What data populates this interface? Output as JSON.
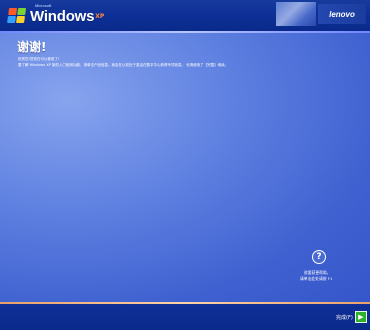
{
  "header": {
    "brand": "Windows",
    "brand_superscript": "Microsoft",
    "brand_edition": "XP",
    "oem_logo": "lenovo"
  },
  "main": {
    "title": "谢谢!",
    "line1": "祝贺您!您现在可以使用了!",
    "line2": "要了解 Windows XP 新的入门使用功能，请单击产品信息。我会在以前处于激活在数字中心获得专项信息。 也请使用了【完整】继续。"
  },
  "help": {
    "icon": "help-icon",
    "line1": "欲要获更帮助，",
    "line2": "请单击此处请按 F1"
  },
  "footer": {
    "finish_label": "完成(F)",
    "finish_icon": "arrow-right-icon"
  },
  "colors": {
    "topbar": "#0d2f96",
    "content": "#5d7fe0",
    "bottombar": "#0b2a8c",
    "accent_orange": "#ffb67a",
    "finish_green": "#2fb12c"
  }
}
